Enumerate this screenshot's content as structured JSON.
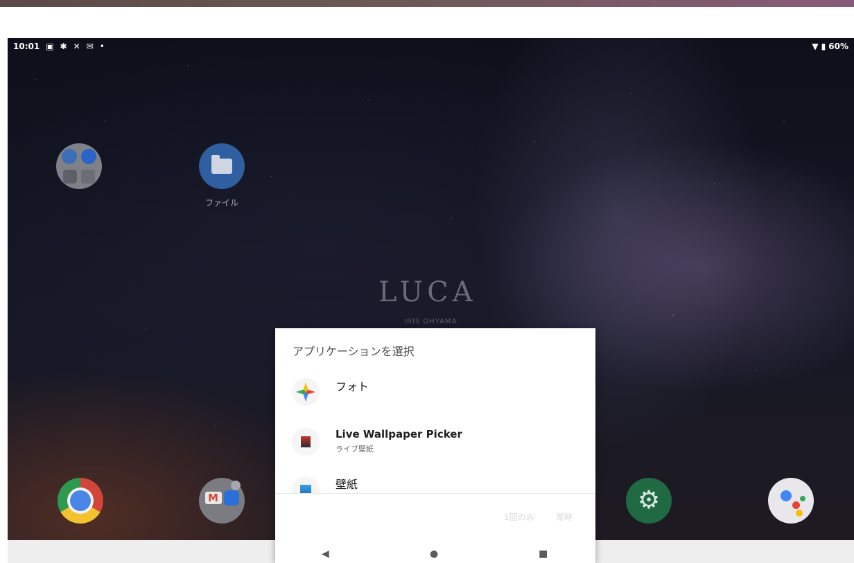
{
  "status_bar": {
    "time": "10:01",
    "left_icons": [
      "image-icon",
      "slack-icon",
      "x-icon",
      "gmail-icon",
      "dot-icon"
    ],
    "battery": "60%"
  },
  "home": {
    "icons": [
      {
        "name": "contacts",
        "label": ""
      },
      {
        "name": "files",
        "label": "ファイル"
      }
    ],
    "wallpaper_logo": "LUCA",
    "wallpaper_sub": "IRIS OHYAMA",
    "dock": [
      "chrome",
      "google-folder",
      "settings",
      "assistant"
    ]
  },
  "dialog": {
    "title": "アプリケーションを選択",
    "apps": [
      {
        "name": "フォト",
        "subtitle": ""
      },
      {
        "name": "Live Wallpaper Picker",
        "subtitle": "ライブ壁紙"
      },
      {
        "name": "壁紙",
        "subtitle": ""
      }
    ],
    "btn_once": "1回のみ",
    "btn_always": "常時"
  },
  "nav": {
    "back": "◀",
    "home": "●",
    "recent": "■"
  }
}
